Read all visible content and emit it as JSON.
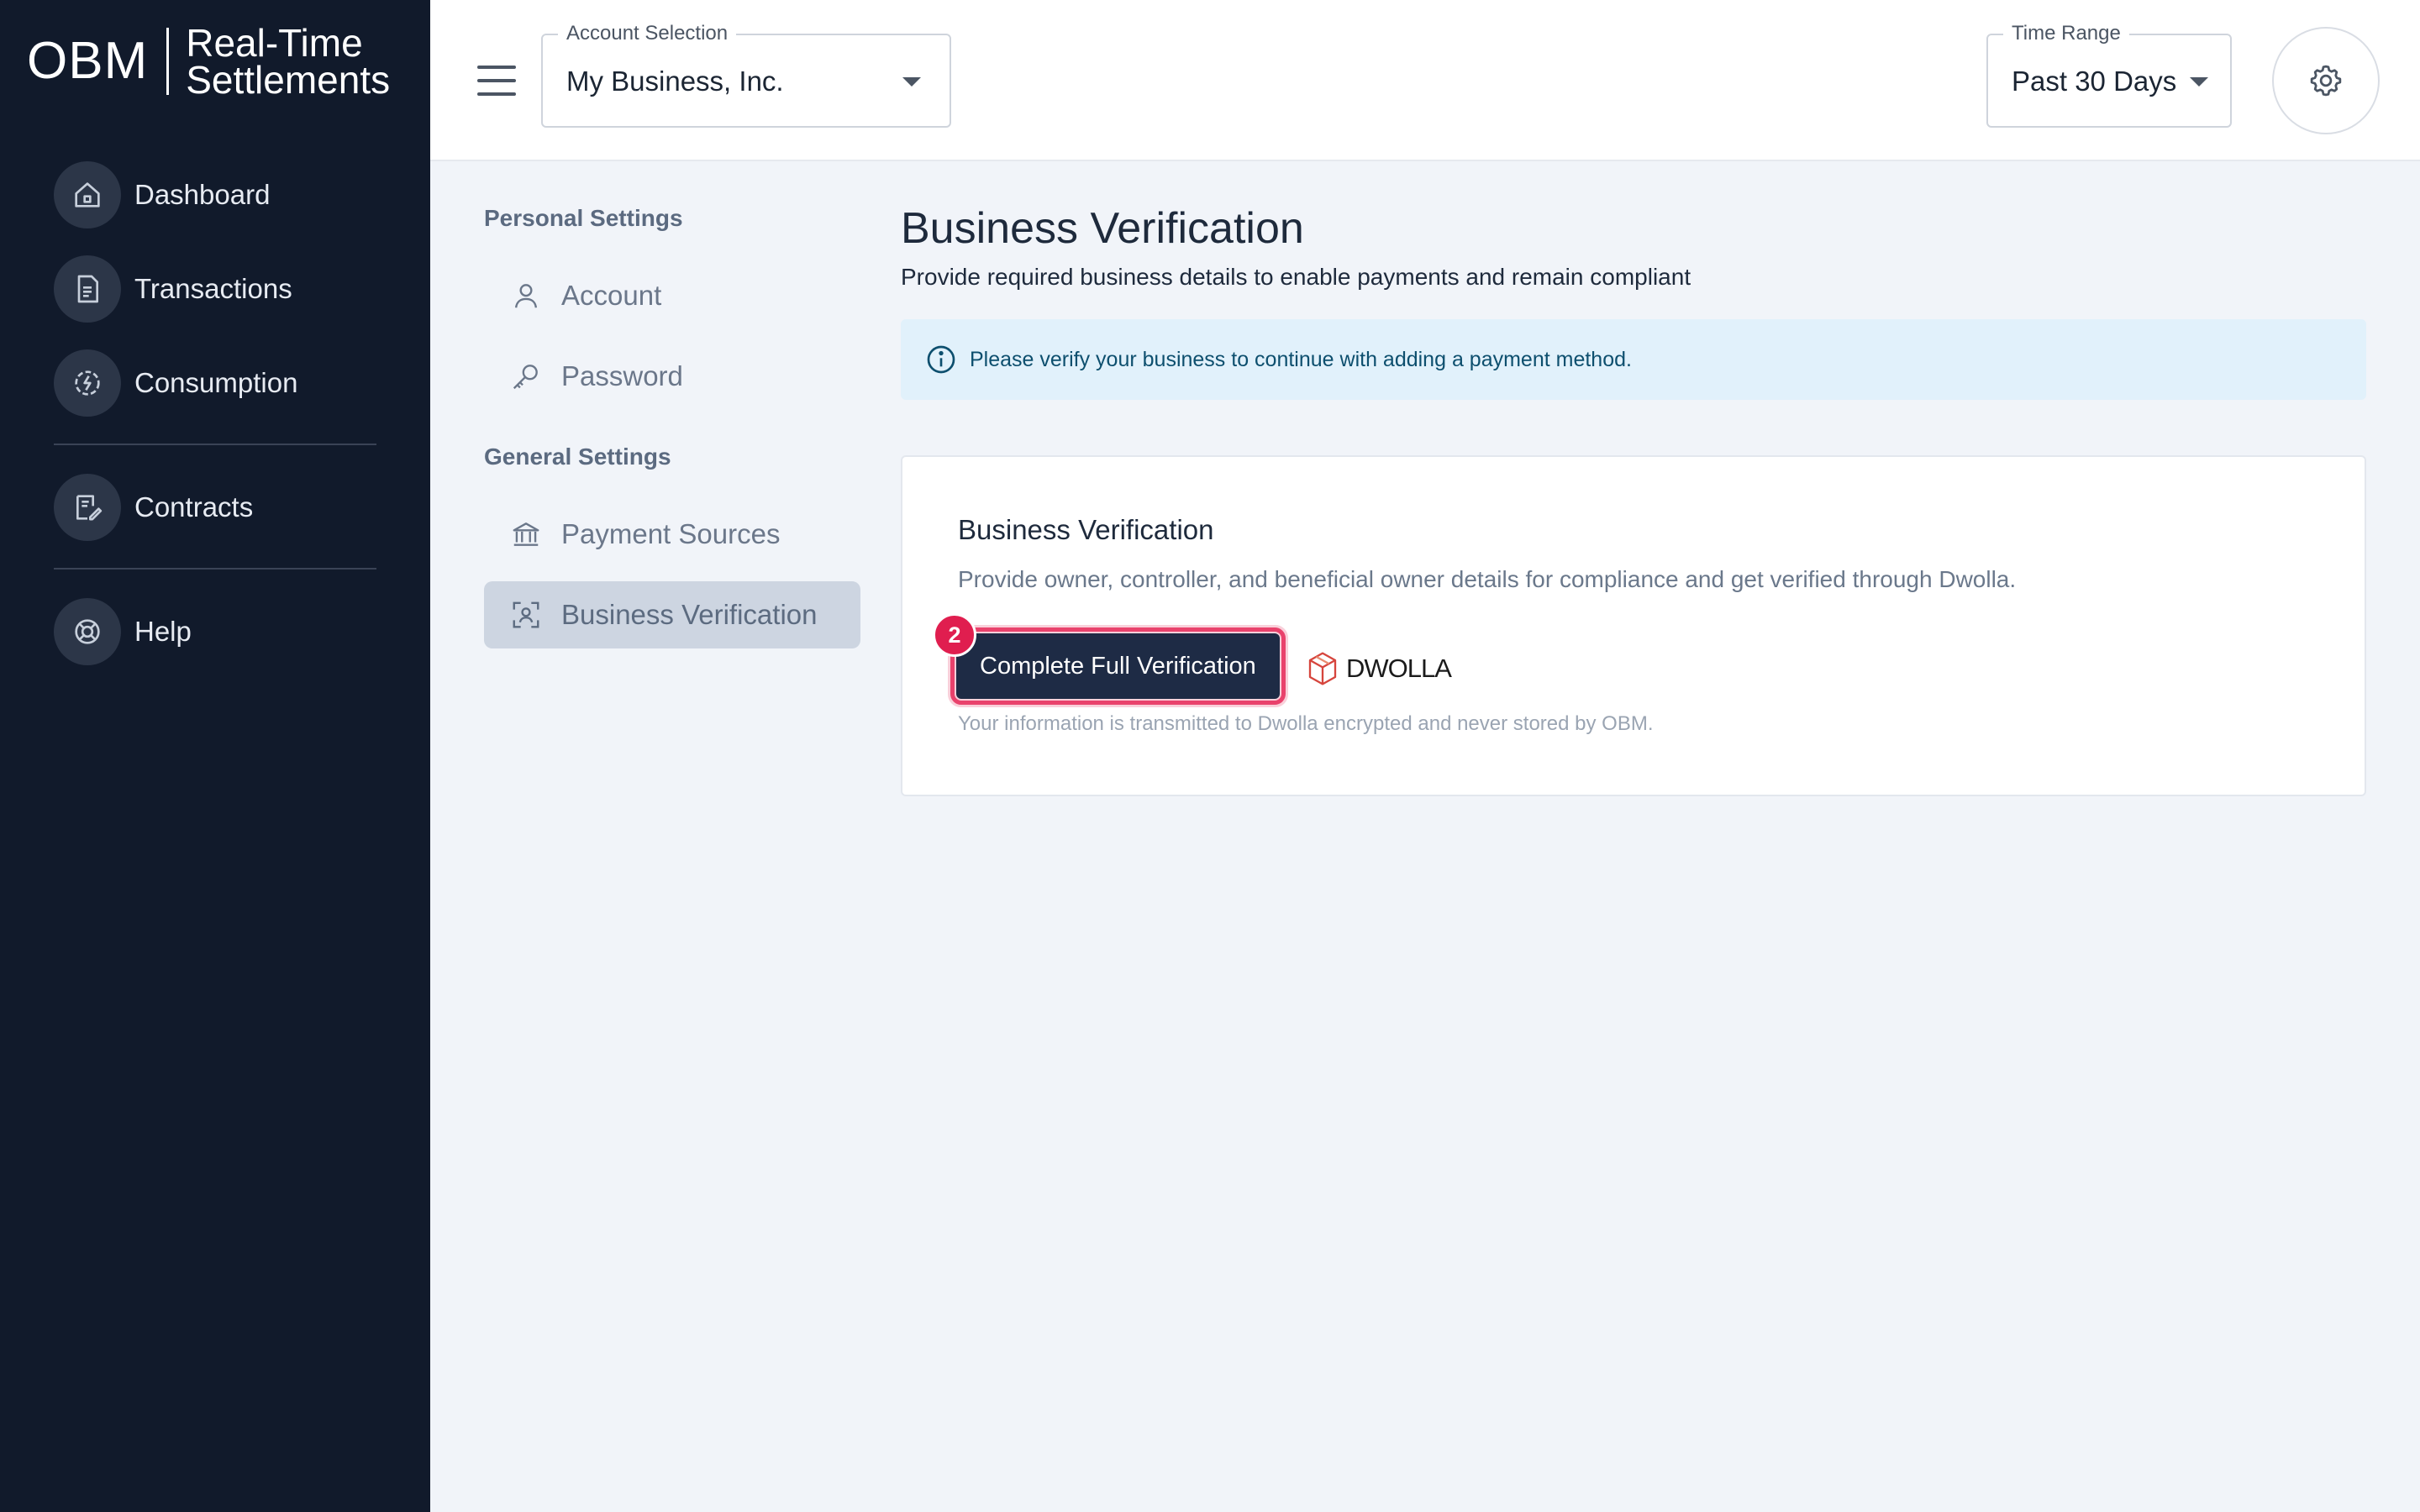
{
  "brand": {
    "mark": "OBM",
    "line1": "Real-Time",
    "line2": "Settlements"
  },
  "sidebar": {
    "items": [
      {
        "label": "Dashboard",
        "icon": "home-icon"
      },
      {
        "label": "Transactions",
        "icon": "document-icon"
      },
      {
        "label": "Consumption",
        "icon": "energy-icon"
      },
      {
        "label": "Contracts",
        "icon": "contract-icon"
      },
      {
        "label": "Help",
        "icon": "lifebuoy-icon"
      }
    ]
  },
  "topbar": {
    "account": {
      "legend": "Account Selection",
      "value": "My Business, Inc."
    },
    "time_range": {
      "legend": "Time Range",
      "value": "Past 30 Days"
    }
  },
  "settings_nav": {
    "personal_heading": "Personal Settings",
    "personal_items": [
      {
        "label": "Account",
        "icon": "user-icon"
      },
      {
        "label": "Password",
        "icon": "key-icon"
      }
    ],
    "general_heading": "General Settings",
    "general_items": [
      {
        "label": "Payment Sources",
        "icon": "bank-icon"
      },
      {
        "label": "Business Verification",
        "icon": "scan-user-icon",
        "active": true
      }
    ]
  },
  "main": {
    "title": "Business Verification",
    "subtitle": "Provide required business details to enable payments and remain compliant",
    "alert": "Please verify your business to continue with adding a payment method.",
    "card": {
      "title": "Business Verification",
      "description": "Provide owner, controller, and beneficial owner details for compliance and get verified through Dwolla.",
      "button_label": "Complete Full Verification",
      "step_badge": "2",
      "partner_logo": "DWOLLA",
      "note": "Your information is transmitted to Dwolla encrypted and never stored by OBM."
    }
  },
  "colors": {
    "sidebar_bg": "#111a2b",
    "primary_button": "#1e2b45",
    "highlight": "#e01e4f",
    "alert_bg": "#e1f1fb",
    "active_item_bg": "#cdd5e1"
  }
}
